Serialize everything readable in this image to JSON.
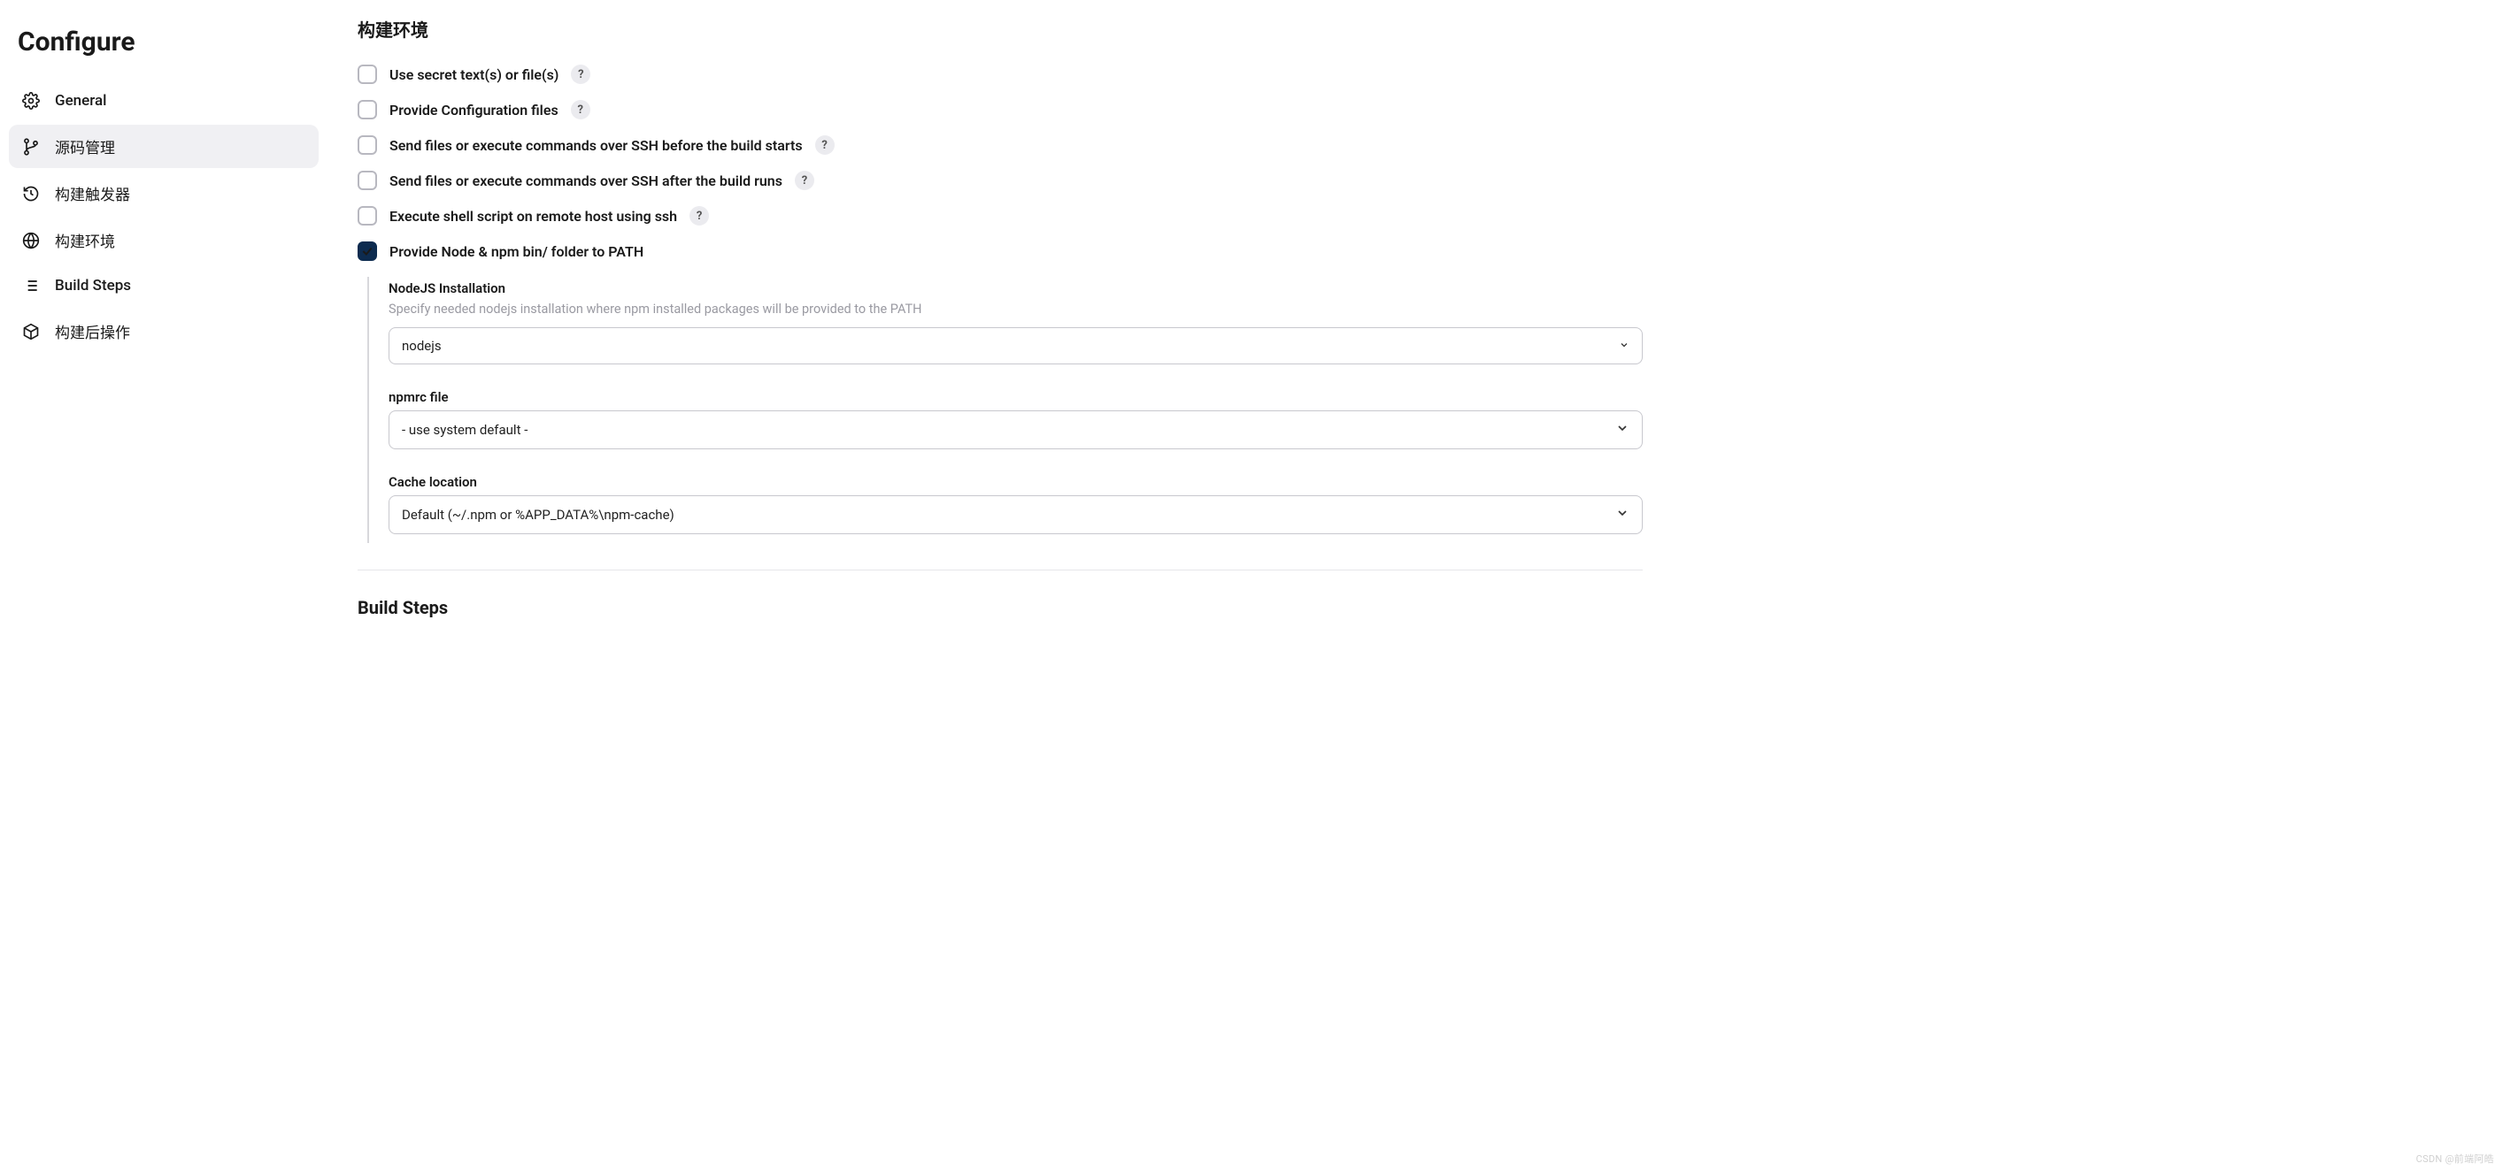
{
  "sidebar": {
    "title": "Configure",
    "items": [
      {
        "label": "General"
      },
      {
        "label": "源码管理"
      },
      {
        "label": "构建触发器"
      },
      {
        "label": "构建环境"
      },
      {
        "label": "Build Steps"
      },
      {
        "label": "构建后操作"
      }
    ]
  },
  "section": {
    "title": "构建环境",
    "options": [
      {
        "label": "Use secret text(s) or file(s)",
        "help": "?"
      },
      {
        "label": "Provide Configuration files",
        "help": "?"
      },
      {
        "label": "Send files or execute commands over SSH before the build starts",
        "help": "?"
      },
      {
        "label": "Send files or execute commands over SSH after the build runs",
        "help": "?"
      },
      {
        "label": "Execute shell script on remote host using ssh",
        "help": "?"
      },
      {
        "label": "Provide Node & npm bin/ folder to PATH"
      }
    ],
    "node": {
      "install_label": "NodeJS Installation",
      "install_desc": "Specify needed nodejs installation where npm installed packages will be provided to the PATH",
      "install_value": "nodejs",
      "npmrc_label": "npmrc file",
      "npmrc_value": "- use system default -",
      "cache_label": "Cache location",
      "cache_value": "Default (~/.npm or %APP_DATA%\\npm-cache)"
    }
  },
  "next_section_title": "Build Steps",
  "watermark": "CSDN @前端阿皓"
}
